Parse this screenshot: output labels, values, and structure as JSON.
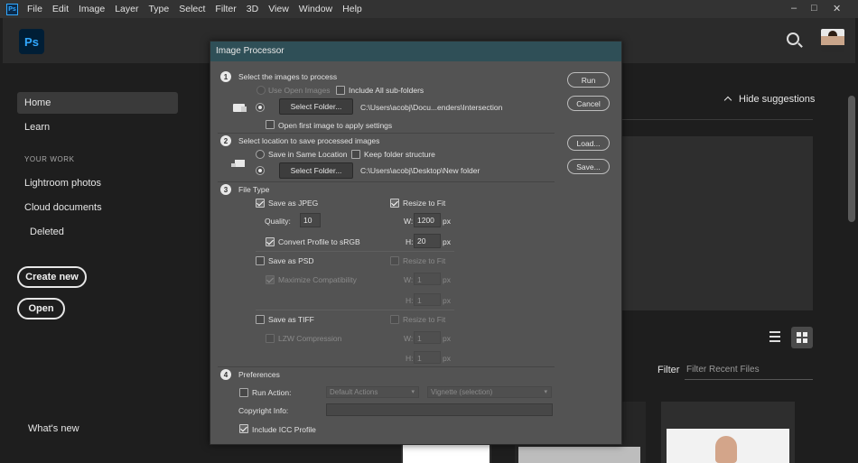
{
  "menubar": {
    "app_badge": "Ps",
    "items": [
      "File",
      "Edit",
      "Image",
      "Layer",
      "Type",
      "Select",
      "Filter",
      "3D",
      "View",
      "Window",
      "Help"
    ],
    "window_controls": [
      "–",
      "□",
      "✕"
    ]
  },
  "home": {
    "logo": "Ps",
    "sidebar": {
      "home": "Home",
      "learn": "Learn",
      "section": "YOUR WORK",
      "lightroom": "Lightroom photos",
      "cloud": "Cloud documents",
      "deleted": "Deleted",
      "create_new": "Create new",
      "open": "Open",
      "whats_new": "What's new"
    },
    "hide_suggestions": "Hide suggestions",
    "filter_label": "Filter",
    "filter_placeholder": "Filter Recent Files",
    "icons": [
      "search-icon",
      "avatar",
      "list-view-icon",
      "grid-view-icon",
      "chevron-up-icon"
    ]
  },
  "dialog": {
    "title": "Image Processor",
    "step1": {
      "num": "1",
      "heading": "Select the images to process",
      "use_open_images": "Use Open Images",
      "include_subfolders": "Include All sub-folders",
      "select_folder": "Select Folder...",
      "path": "C:\\Users\\acobj\\Docu...enders\\Intersection",
      "open_first": "Open first image to apply settings"
    },
    "step2": {
      "num": "2",
      "heading": "Select location to save processed images",
      "same_location": "Save in Same Location",
      "keep_structure": "Keep folder structure",
      "select_folder": "Select Folder...",
      "path": "C:\\Users\\acobj\\Desktop\\New folder"
    },
    "step3": {
      "num": "3",
      "heading": "File Type",
      "jpeg": {
        "label": "Save as JPEG",
        "checked": true,
        "resize": "Resize to Fit",
        "quality_label": "Quality:",
        "quality": "10",
        "w_label": "W:",
        "w": "1200",
        "h_label": "H:",
        "h": "20",
        "unit": "px",
        "srgb": "Convert Profile to sRGB"
      },
      "psd": {
        "label": "Save as PSD",
        "resize": "Resize to Fit",
        "compat": "Maximize Compatibility",
        "w_label": "W:",
        "w": "1",
        "h_label": "H:",
        "h": "1",
        "unit": "px"
      },
      "tiff": {
        "label": "Save as TIFF",
        "resize": "Resize to Fit",
        "lzw": "LZW Compression",
        "w_label": "W:",
        "w": "1",
        "h_label": "H:",
        "h": "1",
        "unit": "px"
      }
    },
    "step4": {
      "num": "4",
      "heading": "Preferences",
      "run_action": "Run Action:",
      "action_set": "Default Actions",
      "action": "Vignette (selection)",
      "copyright": "Copyright Info:",
      "icc": "Include ICC Profile"
    },
    "buttons": {
      "run": "Run",
      "cancel": "Cancel",
      "load": "Load...",
      "save": "Save..."
    }
  }
}
